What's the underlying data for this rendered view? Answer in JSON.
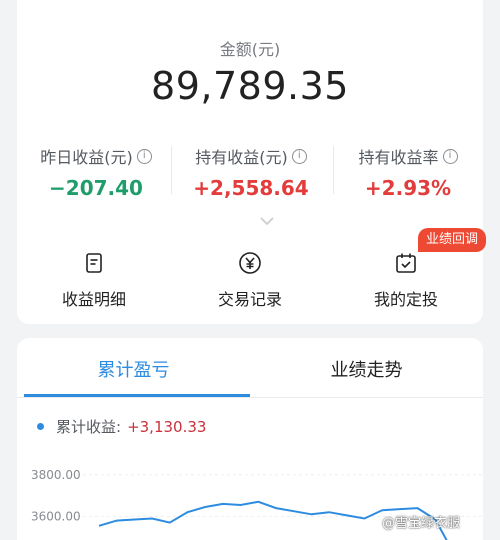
{
  "summary": {
    "amount_label": "金额(元)",
    "amount_value": "89,789.35"
  },
  "stats": [
    {
      "label": "昨日收益(元)",
      "value": "−207.40",
      "tone": "negative"
    },
    {
      "label": "持有收益(元)",
      "value": "+2,558.64",
      "tone": "positive"
    },
    {
      "label": "持有收益率",
      "value": "+2.93%",
      "tone": "positive"
    }
  ],
  "actions": [
    {
      "label": "收益明细",
      "icon": "document-icon"
    },
    {
      "label": "交易记录",
      "icon": "yen-coin-icon"
    },
    {
      "label": "我的定投",
      "icon": "calendar-check-icon"
    }
  ],
  "badge": "业绩回调",
  "tabs": [
    {
      "label": "累计盈亏",
      "active": true
    },
    {
      "label": "业绩走势",
      "active": false
    }
  ],
  "cumulative": {
    "label": "累计收益:",
    "value": "+3,130.33"
  },
  "colors": {
    "accent": "#2d8ce0",
    "positive": "#e23c3c",
    "negative": "#1f9d6b",
    "badge": "#ee4a33"
  },
  "chart_data": {
    "type": "line",
    "y_ticks": [
      "3800.00",
      "3600.00"
    ],
    "ylim": [
      3400,
      3900
    ],
    "series": [
      {
        "values": [
          3555,
          3580,
          3585,
          3590,
          3570,
          3620,
          3645,
          3660,
          3655,
          3670,
          3640,
          3625,
          3610,
          3620,
          3605,
          3590,
          3630,
          3635,
          3640,
          3585,
          3430
        ]
      }
    ]
  },
  "watermark": "@雪宝绿衣服"
}
